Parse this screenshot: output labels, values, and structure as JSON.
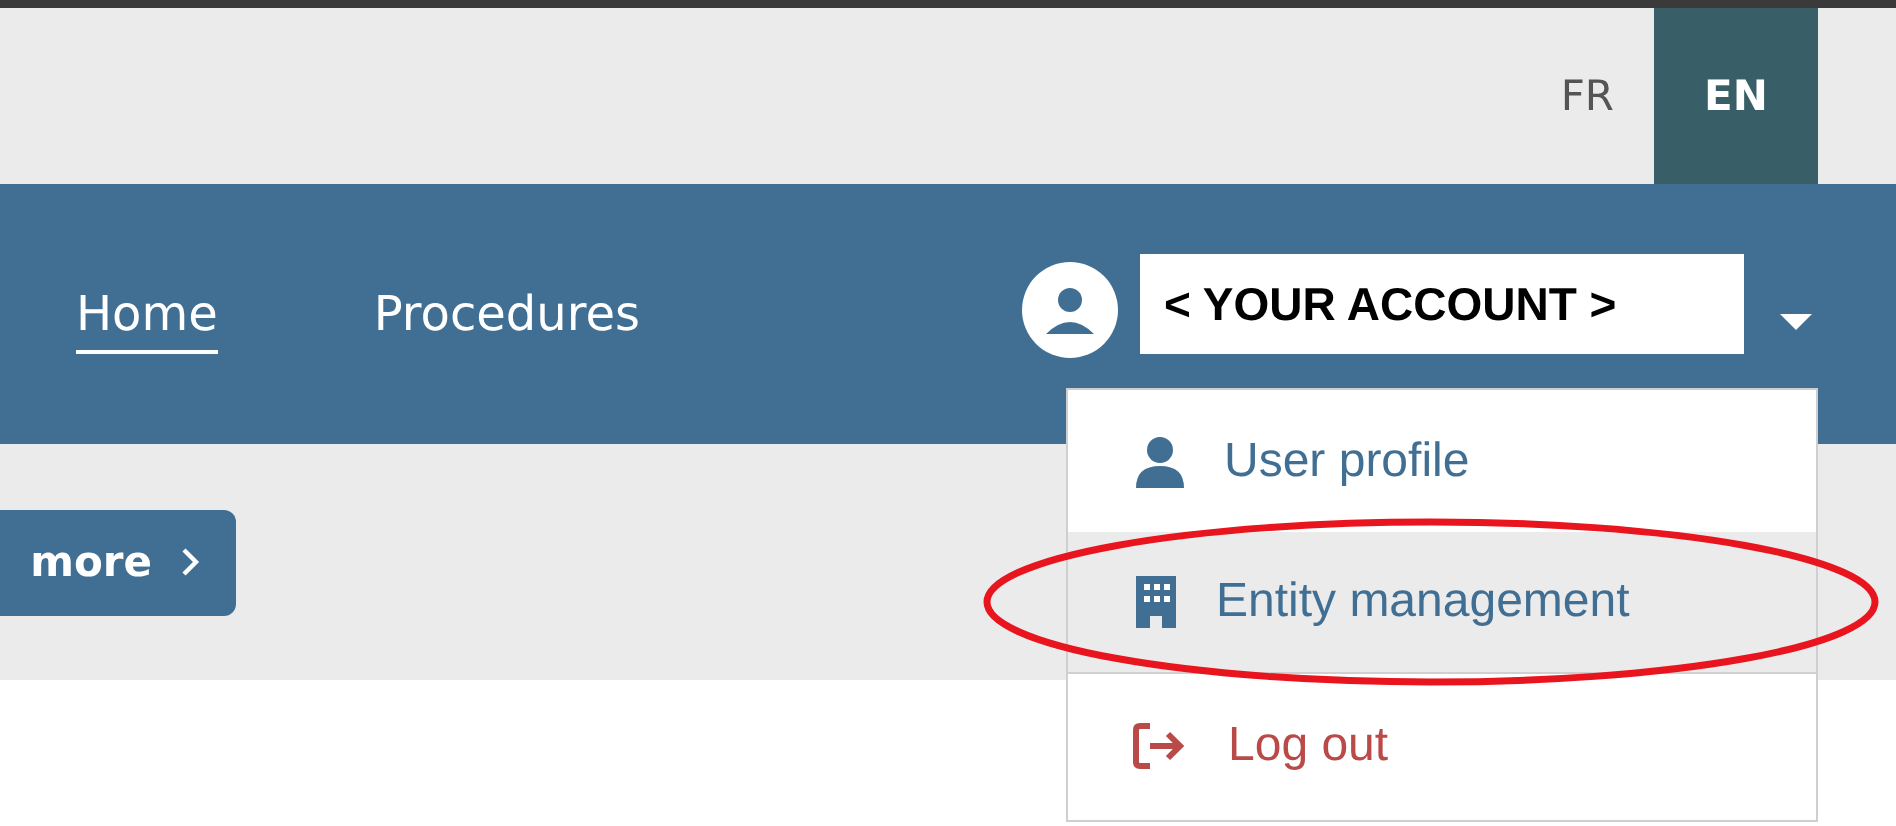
{
  "languages": [
    {
      "label": "FR",
      "selected": false
    },
    {
      "label": "EN",
      "selected": true
    }
  ],
  "nav": [
    {
      "label": "Home",
      "selected": true
    },
    {
      "label": "Procedures",
      "selected": false
    }
  ],
  "account": {
    "value": "< YOUR ACCOUNT >"
  },
  "more_button": {
    "label": "more"
  },
  "menu": [
    {
      "label": "User profile",
      "kind": "person",
      "selected": false,
      "circled": false
    },
    {
      "label": "Entity management",
      "kind": "building",
      "selected": true,
      "circled": true
    },
    {
      "label": "Log out",
      "kind": "logout",
      "selected": false,
      "circled": false
    }
  ]
}
